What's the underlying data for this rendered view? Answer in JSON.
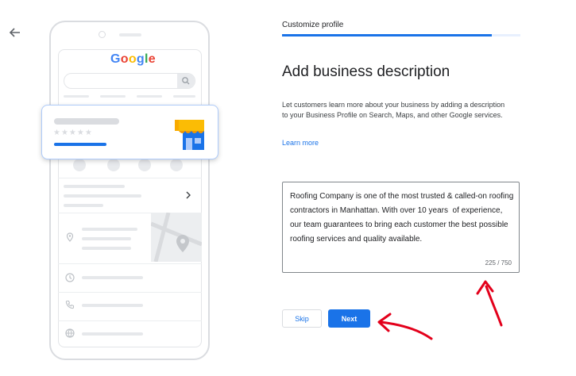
{
  "illustration": {
    "logo_letters": [
      "G",
      "o",
      "o",
      "g",
      "l",
      "e"
    ],
    "stars": "★★★★★"
  },
  "wizard": {
    "step_label": "Customize profile",
    "progress_fraction": 0.88,
    "heading": "Add business description",
    "description": "Let customers learn more about your business by adding a description to your Business Profile on Search, Maps, and other Google services.",
    "learn_more": "Learn more",
    "business_description": "Roofing Company is one of the most trusted & called-on roofing contractors in Manhattan. With over 10 years  of experience, our team guarantees to bring each customer the best possible roofing services and quality available.",
    "char_counter": "225 / 750",
    "skip_label": "Skip",
    "next_label": "Next"
  },
  "colors": {
    "accent": "#1a73e8",
    "annotation": "#e3001b"
  },
  "icons": [
    "back-arrow-icon",
    "search-icon",
    "chevron-right-icon",
    "location-pin-icon",
    "clock-icon",
    "phone-icon",
    "globe-icon",
    "storefront-icon"
  ]
}
